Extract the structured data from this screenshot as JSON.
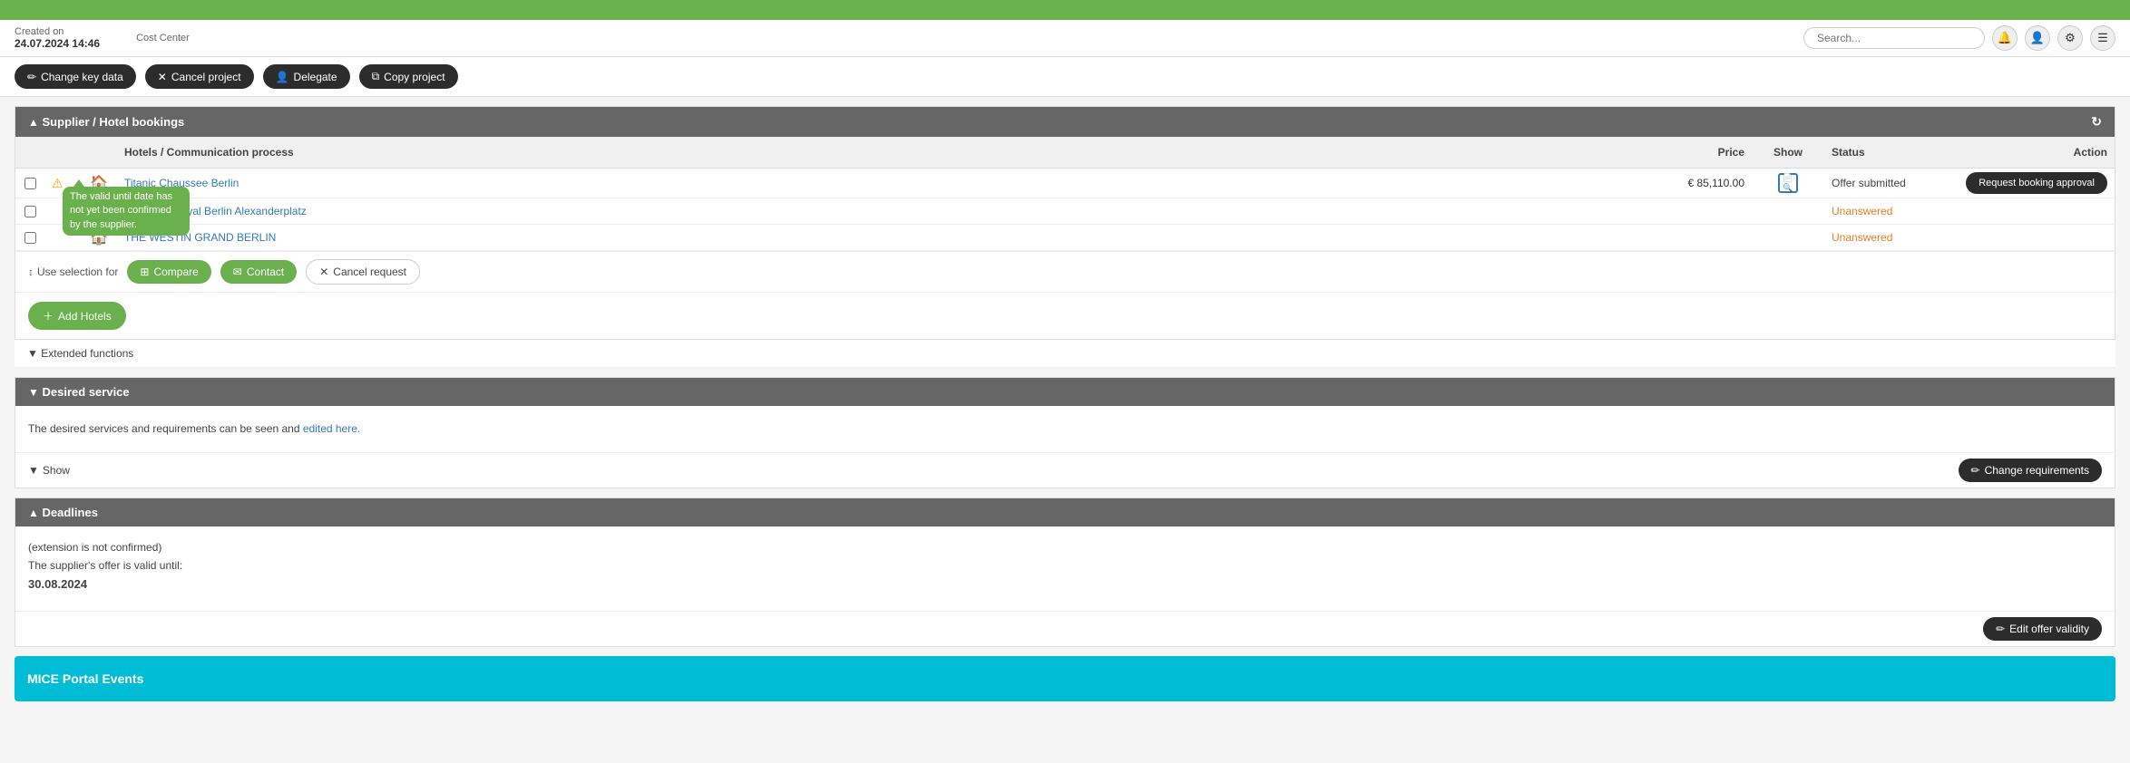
{
  "topbar": {
    "color": "#6ab04c"
  },
  "header": {
    "created_on_label": "Created on",
    "created_on_value": "24.07.2024 14:46",
    "cost_center_label": "Cost Center",
    "search_placeholder": "Search..."
  },
  "action_buttons": {
    "change_key_data": "Change key data",
    "cancel_project": "Cancel project",
    "delegate": "Delegate",
    "copy_project": "Copy project"
  },
  "supplier_section": {
    "title": "Supplier / Hotel bookings",
    "table": {
      "columns": [
        "",
        "",
        "",
        "Hotels / Communication process",
        "Price",
        "Show",
        "Status",
        "Action"
      ],
      "rows": [
        {
          "id": 1,
          "name": "Titanic Chaussee Berlin",
          "price": "€ 85,110.00",
          "status": "Offer submitted",
          "status_type": "submitted",
          "action": "Request booking approval",
          "has_warning": true,
          "has_show_icon": true
        },
        {
          "id": 2,
          "name": "Leonardo Royal Berlin Alexanderplatz",
          "price": "",
          "status": "Unanswered",
          "status_type": "unanswered",
          "action": "",
          "has_warning": false,
          "has_show_icon": false
        },
        {
          "id": 3,
          "name": "THE WESTIN GRAND BERLIN",
          "price": "",
          "status": "Unanswered",
          "status_type": "unanswered",
          "action": "",
          "has_warning": false,
          "has_show_icon": false
        }
      ]
    },
    "selection_bar": {
      "label": "Use selection for",
      "compare": "Compare",
      "contact": "Contact",
      "cancel_request": "Cancel request"
    },
    "add_hotels_label": "Add Hotels"
  },
  "tooltip": {
    "text": "The valid until date has not yet been confirmed by the supplier."
  },
  "extended_functions": {
    "label": "Extended functions"
  },
  "desired_service": {
    "title": "Desired service",
    "description_text": "The desired services and requirements can be seen and edited here.",
    "description_link": "edited here.",
    "show_label": "Show",
    "change_requirements_label": "Change requirements"
  },
  "deadlines": {
    "title": "Deadlines",
    "extension_note": "(extension is not confirmed)",
    "offer_validity_label": "The supplier's offer is valid until:",
    "offer_validity_date": "30.08.2024",
    "edit_offer_validity_label": "Edit offer validity"
  },
  "mice_portal": {
    "title": "MICE Portal Events"
  }
}
